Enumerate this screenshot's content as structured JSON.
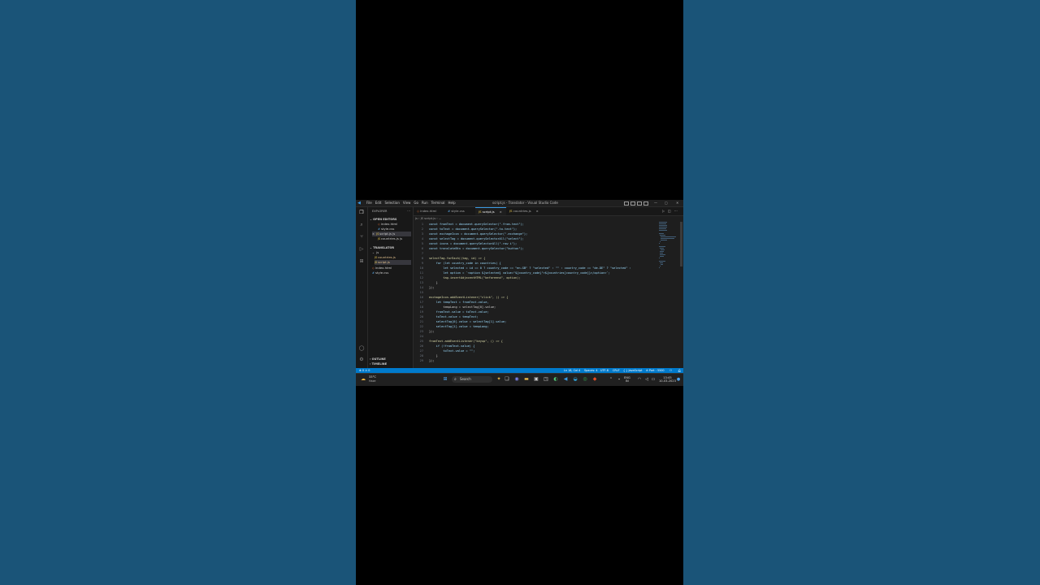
{
  "window": {
    "title": "script.js - Translator - Visual Studio Code",
    "menu": [
      "File",
      "Edit",
      "Selection",
      "View",
      "Go",
      "Run",
      "Terminal",
      "Help"
    ]
  },
  "sidebar": {
    "header": "EXPLORER",
    "open_editors_label": "OPEN EDITORS",
    "open_editors": [
      {
        "name": "index.html",
        "type": "html"
      },
      {
        "name": "style.css",
        "type": "css"
      },
      {
        "name": "script.js js",
        "type": "js",
        "close": "×",
        "selected": true
      },
      {
        "name": "countries.js js",
        "type": "js"
      }
    ],
    "project_label": "TRANSLATOR",
    "tree": [
      {
        "name": "js",
        "type": "folder"
      },
      {
        "name": "countries.js",
        "type": "js"
      },
      {
        "name": "script.js",
        "type": "js",
        "selected": true
      },
      {
        "name": "index.html",
        "type": "html"
      },
      {
        "name": "style.css",
        "type": "css"
      }
    ],
    "outline_label": "OUTLINE",
    "timeline_label": "TIMELINE"
  },
  "tabs": [
    {
      "label": "index.html",
      "type": "html"
    },
    {
      "label": "style.css",
      "type": "css"
    },
    {
      "label": "script.js",
      "type": "js",
      "active": true,
      "close": "×"
    },
    {
      "label": "countries.js",
      "type": "js",
      "close": "×"
    }
  ],
  "breadcrumb": "js › JS script.js › ...",
  "code": [
    {
      "n": "1",
      "t": "const fromText = document.querySelector(\".from-text\");"
    },
    {
      "n": "2",
      "t": "const toText = document.querySelector(\".to-text\");"
    },
    {
      "n": "3",
      "t": "const exchageIcon = document.querySelector(\".exchange\");"
    },
    {
      "n": "4",
      "t": "const selectTag = document.querySelectorAll(\"select\");"
    },
    {
      "n": "5",
      "t": "const icons = document.querySelectorAll(\".row i\");"
    },
    {
      "n": "6",
      "t": "const translateBtn = document.querySelector(\"button\");"
    },
    {
      "n": "7",
      "t": ""
    },
    {
      "n": "8",
      "t": "selectTag.forEach((tag, id) => {"
    },
    {
      "n": "9",
      "t": "    for (let country_code in countries) {"
    },
    {
      "n": "10",
      "t": "        let selected = id == 0 ? country_code == \"en-GB\" ? \"selected\" : \"\" : country_code == \"de-DE\" ? \"selected\" :"
    },
    {
      "n": "11",
      "t": "        let option = `<option ${selected} value=\"${country_code}\">${countries[country_code]}</option>`;"
    },
    {
      "n": "12",
      "t": "        tag.insertAdjacentHTML(\"beforeend\", option);"
    },
    {
      "n": "13",
      "t": "    }"
    },
    {
      "n": "14",
      "t": "});"
    },
    {
      "n": "15",
      "t": ""
    },
    {
      "n": "16",
      "t": "exchageIcon.addEventListener(\"click\", () => {"
    },
    {
      "n": "17",
      "t": "    let tempText = fromText.value,"
    },
    {
      "n": "18",
      "t": "        tempLang = selectTag[0].value;"
    },
    {
      "n": "19",
      "t": "    fromText.value = toText.value;"
    },
    {
      "n": "20",
      "t": "    toText.value = tempText;"
    },
    {
      "n": "21",
      "t": "    selectTag[0].value = selectTag[1].value;"
    },
    {
      "n": "22",
      "t": "    selectTag[1].value = tempLang;"
    },
    {
      "n": "23",
      "t": "});"
    },
    {
      "n": "24",
      "t": ""
    },
    {
      "n": "25",
      "t": "fromText.addEventListener(\"keyup\", () => {"
    },
    {
      "n": "26",
      "t": "    if (!fromText.value) {"
    },
    {
      "n": "27",
      "t": "        toText.value = \"\";"
    },
    {
      "n": "28",
      "t": "    }"
    },
    {
      "n": "29",
      "t": "});"
    }
  ],
  "status": {
    "left": "⊗ 0 ⚠ 0",
    "position": "Ln 18, Col 4",
    "spaces": "Spaces: 4",
    "encoding": "UTF-8",
    "eol": "CRLF",
    "language": "{ } JavaScript",
    "port": "⊘ Port : 5500"
  },
  "taskbar": {
    "weather_temp": "33°C",
    "weather_desc": "Haze",
    "search_placeholder": "Search",
    "lang": "ENG",
    "lang_region": "IN",
    "time": "13:45",
    "date": "10-03-2023"
  },
  "colors": {
    "status_bar": "#007acc",
    "accent": "#3b9ae1",
    "keyword": "#569cd6",
    "variable": "#9cdcfe",
    "function": "#dcdcaa",
    "string": "#ce9178"
  }
}
